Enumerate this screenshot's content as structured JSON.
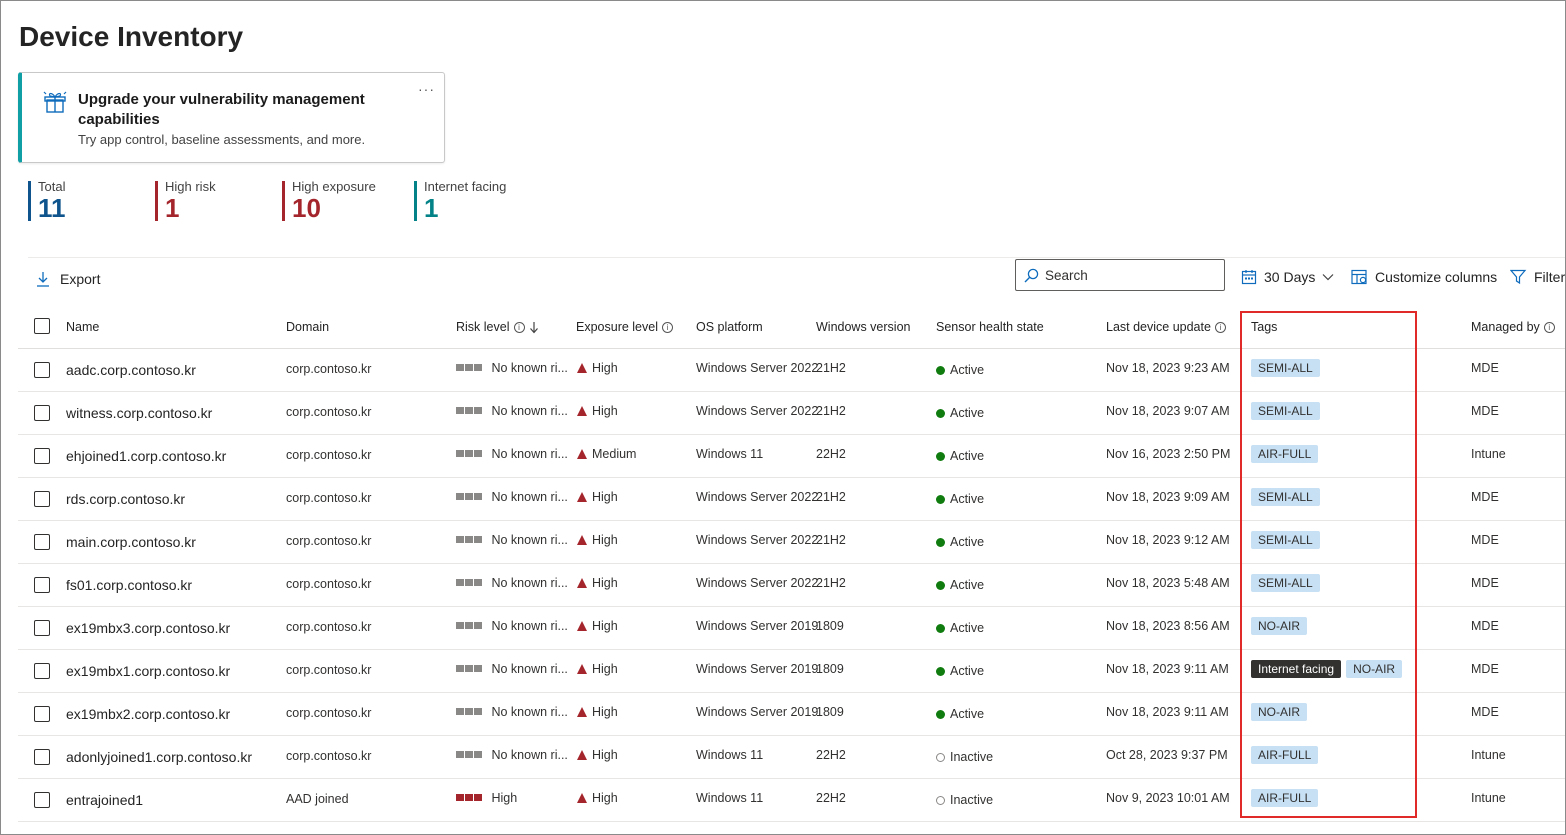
{
  "page": {
    "title": "Device Inventory"
  },
  "promo": {
    "title": "Upgrade your vulnerability management capabilities",
    "subtitle": "Try app control, baseline assessments, and more.",
    "more": "···",
    "icon": "upgrade-gift-icon"
  },
  "stats": [
    {
      "label": "Total",
      "value": "11",
      "color": "#0f548c"
    },
    {
      "label": "High risk",
      "value": "1",
      "color": "#a4262c"
    },
    {
      "label": "High exposure",
      "value": "10",
      "color": "#a4262c"
    },
    {
      "label": "Internet facing",
      "value": "1",
      "color": "#038387"
    }
  ],
  "toolbar": {
    "export_label": "Export",
    "search_placeholder": "Search",
    "days_label": "30 Days",
    "customize_label": "Customize columns",
    "filter_label": "Filter"
  },
  "columns": {
    "name": "Name",
    "domain": "Domain",
    "risk": "Risk level",
    "exposure": "Exposure level",
    "os": "OS platform",
    "winver": "Windows version",
    "sensor": "Sensor health state",
    "lastupdate": "Last device update",
    "tags": "Tags",
    "managed": "Managed by"
  },
  "rows": [
    {
      "name": "aadc.corp.contoso.kr",
      "domain": "corp.contoso.kr",
      "risk": "No known ri...",
      "risk_high": false,
      "exposure": "High",
      "os": "Windows Server 2022",
      "winver": "21H2",
      "sensor": "Active",
      "active": true,
      "updated": "Nov 18, 2023 9:23 AM",
      "tags": [
        "SEMI-ALL"
      ],
      "managed": "MDE"
    },
    {
      "name": "witness.corp.contoso.kr",
      "domain": "corp.contoso.kr",
      "risk": "No known ri...",
      "risk_high": false,
      "exposure": "High",
      "os": "Windows Server 2022",
      "winver": "21H2",
      "sensor": "Active",
      "active": true,
      "updated": "Nov 18, 2023 9:07 AM",
      "tags": [
        "SEMI-ALL"
      ],
      "managed": "MDE"
    },
    {
      "name": "ehjoined1.corp.contoso.kr",
      "domain": "corp.contoso.kr",
      "risk": "No known ri...",
      "risk_high": false,
      "exposure": "Medium",
      "os": "Windows 11",
      "winver": "22H2",
      "sensor": "Active",
      "active": true,
      "updated": "Nov 16, 2023 2:50 PM",
      "tags": [
        "AIR-FULL"
      ],
      "managed": "Intune"
    },
    {
      "name": "rds.corp.contoso.kr",
      "domain": "corp.contoso.kr",
      "risk": "No known ri...",
      "risk_high": false,
      "exposure": "High",
      "os": "Windows Server 2022",
      "winver": "21H2",
      "sensor": "Active",
      "active": true,
      "updated": "Nov 18, 2023 9:09 AM",
      "tags": [
        "SEMI-ALL"
      ],
      "managed": "MDE"
    },
    {
      "name": "main.corp.contoso.kr",
      "domain": "corp.contoso.kr",
      "risk": "No known ri...",
      "risk_high": false,
      "exposure": "High",
      "os": "Windows Server 2022",
      "winver": "21H2",
      "sensor": "Active",
      "active": true,
      "updated": "Nov 18, 2023 9:12 AM",
      "tags": [
        "SEMI-ALL"
      ],
      "managed": "MDE"
    },
    {
      "name": "fs01.corp.contoso.kr",
      "domain": "corp.contoso.kr",
      "risk": "No known ri...",
      "risk_high": false,
      "exposure": "High",
      "os": "Windows Server 2022",
      "winver": "21H2",
      "sensor": "Active",
      "active": true,
      "updated": "Nov 18, 2023 5:48 AM",
      "tags": [
        "SEMI-ALL"
      ],
      "managed": "MDE"
    },
    {
      "name": "ex19mbx3.corp.contoso.kr",
      "domain": "corp.contoso.kr",
      "risk": "No known ri...",
      "risk_high": false,
      "exposure": "High",
      "os": "Windows Server 2019",
      "winver": "1809",
      "sensor": "Active",
      "active": true,
      "updated": "Nov 18, 2023 8:56 AM",
      "tags": [
        "NO-AIR"
      ],
      "managed": "MDE"
    },
    {
      "name": "ex19mbx1.corp.contoso.kr",
      "domain": "corp.contoso.kr",
      "risk": "No known ri...",
      "risk_high": false,
      "exposure": "High",
      "os": "Windows Server 2019",
      "winver": "1809",
      "sensor": "Active",
      "active": true,
      "updated": "Nov 18, 2023 9:11 AM",
      "tags": [
        "Internet facing",
        "NO-AIR"
      ],
      "managed": "MDE"
    },
    {
      "name": "ex19mbx2.corp.contoso.kr",
      "domain": "corp.contoso.kr",
      "risk": "No known ri...",
      "risk_high": false,
      "exposure": "High",
      "os": "Windows Server 2019",
      "winver": "1809",
      "sensor": "Active",
      "active": true,
      "updated": "Nov 18, 2023 9:11 AM",
      "tags": [
        "NO-AIR"
      ],
      "managed": "MDE"
    },
    {
      "name": "adonlyjoined1.corp.contoso.kr",
      "domain": "corp.contoso.kr",
      "risk": "No known ri...",
      "risk_high": false,
      "exposure": "High",
      "os": "Windows 11",
      "winver": "22H2",
      "sensor": "Inactive",
      "active": false,
      "updated": "Oct 28, 2023 9:37 PM",
      "tags": [
        "AIR-FULL"
      ],
      "managed": "Intune"
    },
    {
      "name": "entrajoined1",
      "domain": "AAD joined",
      "risk": "High",
      "risk_high": true,
      "exposure": "High",
      "os": "Windows 11",
      "winver": "22H2",
      "sensor": "Inactive",
      "active": false,
      "updated": "Nov 9, 2023 10:01 AM",
      "tags": [
        "AIR-FULL"
      ],
      "managed": "Intune"
    }
  ]
}
